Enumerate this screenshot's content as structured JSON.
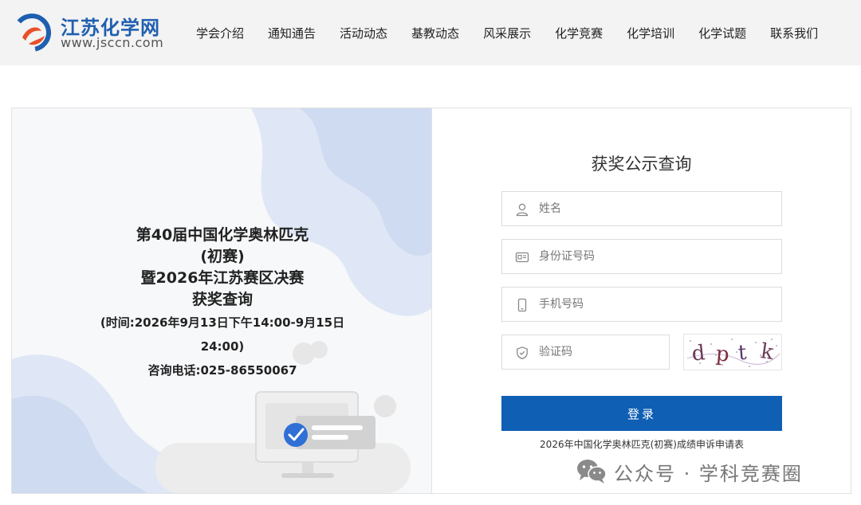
{
  "header": {
    "logo_title": "江苏化学网",
    "logo_url": "www.jsccn.com",
    "brand_colors": {
      "blue": "#1f5fb0",
      "orange": "#e8502a"
    },
    "nav": [
      "学会介绍",
      "通知通告",
      "活动动态",
      "基教动态",
      "风采展示",
      "化学竞赛",
      "化学培训",
      "化学试题",
      "联系我们"
    ]
  },
  "info": {
    "line1": "第40届中国化学奥林匹克",
    "line2": "(初赛)",
    "line3": "暨2026年江苏赛区决赛",
    "line4": "获奖查询",
    "time_line1": "(时间:2026年9月13日下午14:00-9月15日",
    "time_line2": "24:00)",
    "phone": "咨询电话:025-86550067"
  },
  "form": {
    "title": "获奖公示查询",
    "name_placeholder": "姓名",
    "id_placeholder": "身份证号码",
    "phone_placeholder": "手机号码",
    "code_placeholder": "验证码",
    "captcha_text": "dptk",
    "login_label": "登录",
    "appeal_link": "2026年中国化学奥林匹克(初赛)成绩申诉申请表",
    "accent_color": "#0f5fb4"
  },
  "watermark": {
    "text": "公众号 · 学科竞赛圈",
    "icon": "wechat-icon"
  }
}
